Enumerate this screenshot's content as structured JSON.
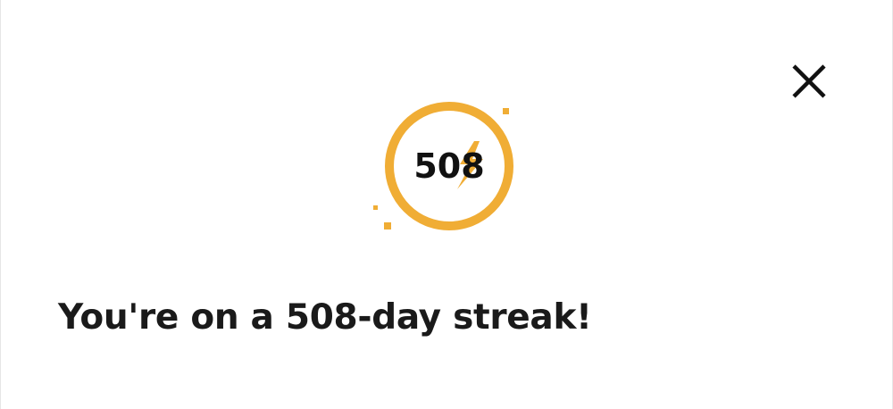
{
  "dialog": {
    "close_icon": "close-icon",
    "streak": {
      "count": "508",
      "badge_icon": "lightning-bolt-icon",
      "accent_color": "#F0AD35"
    },
    "message": "You're on a 508-day streak!"
  }
}
